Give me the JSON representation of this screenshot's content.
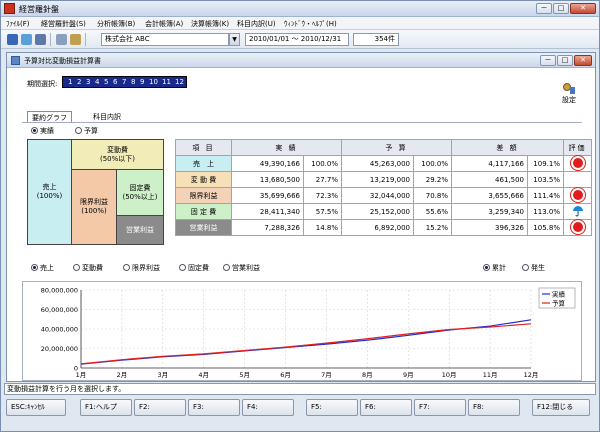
{
  "app": {
    "title": "経営羅針盤"
  },
  "window_buttons": {
    "minimize": "－",
    "maximize": "□",
    "close": "✕"
  },
  "menu": [
    "ﾌｧｲﾙ(F)",
    "経営羅針盤(S)",
    "分析帳簿(B)",
    "会計帳簿(A)",
    "決算帳簿(K)",
    "科目内訳(U)",
    "ｳｨﾝﾄﾞｳ・ﾍﾙﾌﾟ(H)"
  ],
  "toolbar": {
    "company": "株式会社 ABC",
    "date_range": "2010/01/01 ～ 2010/12/31",
    "count": "354件"
  },
  "child": {
    "title": "予算対比変動損益計算書"
  },
  "period": {
    "label": "期間選択:",
    "months": [
      "1",
      "2",
      "3",
      "4",
      "5",
      "6",
      "7",
      "8",
      "9",
      "10",
      "11",
      "12"
    ]
  },
  "settings": {
    "label": "設定"
  },
  "tabs": [
    {
      "label": "要約グラフ",
      "active": true
    },
    {
      "label": "科目内訳",
      "active": false
    }
  ],
  "view_radios": [
    {
      "label": "実績",
      "checked": true
    },
    {
      "label": "予算",
      "checked": false
    }
  ],
  "diagram": {
    "sales": "売上",
    "sales_pct": "(100%)",
    "variable": "変動費",
    "variable_pct": "(50%以下)",
    "marginal": "限界利益",
    "marginal_pct": "(100%)",
    "fixed": "固定費",
    "fixed_pct": "(50%以上)",
    "operating": "営業利益"
  },
  "table": {
    "headers": [
      "項 目",
      "実 績",
      "予 算",
      "差 額",
      "評価"
    ],
    "rows": [
      {
        "item": "売　上",
        "actual": "49,390,166",
        "actual_pct": "100.0%",
        "budget": "45,263,000",
        "budget_pct": "100.0%",
        "diff": "4,117,166",
        "diff_pct": "109.1%",
        "eval": "sun"
      },
      {
        "item": "変 動 費",
        "actual": "13,680,500",
        "actual_pct": "27.7%",
        "budget": "13,219,000",
        "budget_pct": "29.2%",
        "diff": "461,500",
        "diff_pct": "103.5%",
        "eval": ""
      },
      {
        "item": "限界利益",
        "actual": "35,699,666",
        "actual_pct": "72.3%",
        "budget": "32,044,000",
        "budget_pct": "70.8%",
        "diff": "3,655,666",
        "diff_pct": "111.4%",
        "eval": "sun"
      },
      {
        "item": "固 定 費",
        "actual": "28,411,340",
        "actual_pct": "57.5%",
        "budget": "25,152,000",
        "budget_pct": "55.6%",
        "diff": "3,259,340",
        "diff_pct": "113.0%",
        "eval": "umbrella"
      },
      {
        "item": "営業利益",
        "actual": "7,288,326",
        "actual_pct": "14.8%",
        "budget": "6,892,000",
        "budget_pct": "15.2%",
        "diff": "396,326",
        "diff_pct": "105.8%",
        "eval": "sun"
      }
    ]
  },
  "series_radios": [
    {
      "label": "売上",
      "checked": true
    },
    {
      "label": "変動費",
      "checked": false
    },
    {
      "label": "限界利益",
      "checked": false
    },
    {
      "label": "固定費",
      "checked": false
    },
    {
      "label": "営業利益",
      "checked": false
    }
  ],
  "accum_radios": [
    {
      "label": "累計",
      "checked": true
    },
    {
      "label": "発生",
      "checked": false
    }
  ],
  "colors": {
    "actual_line": "#1f2bd6",
    "budget_line": "#e02020",
    "row_sales": "#c8eef2",
    "row_variable": "#f7e0b7",
    "row_marginal": "#f3d2b8",
    "row_fixed": "#cdf0c8",
    "row_operating": "#8b8b8b"
  },
  "chart_data": {
    "type": "line",
    "categories": [
      "1月",
      "2月",
      "3月",
      "4月",
      "5月",
      "6月",
      "7月",
      "8月",
      "9月",
      "10月",
      "11月",
      "12月"
    ],
    "series": [
      {
        "name": "実績",
        "values": [
          4000000,
          8000000,
          11500000,
          14000000,
          17500000,
          21000000,
          24500000,
          28500000,
          33500000,
          39000000,
          43000000,
          49400000
        ]
      },
      {
        "name": "予算",
        "values": [
          4200000,
          8500000,
          12000000,
          14500000,
          18000000,
          21500000,
          25500000,
          30000000,
          35000000,
          39500000,
          42000000,
          45300000
        ]
      }
    ],
    "ylim": [
      0,
      80000000
    ],
    "yticks": [
      "0",
      "20,000,000",
      "40,000,000",
      "60,000,000",
      "80,000,000"
    ],
    "legend_placement": "top-right",
    "grid": true
  },
  "status": {
    "text": "変動損益計算を行う月を選択します。"
  },
  "fkeys": [
    "ESC:ｷｬﾝｾﾙ",
    "F1:ヘルプ",
    "F2:",
    "F3:",
    "F4:",
    "F5:",
    "F6:",
    "F7:",
    "F8:",
    "F12:閉じる"
  ]
}
